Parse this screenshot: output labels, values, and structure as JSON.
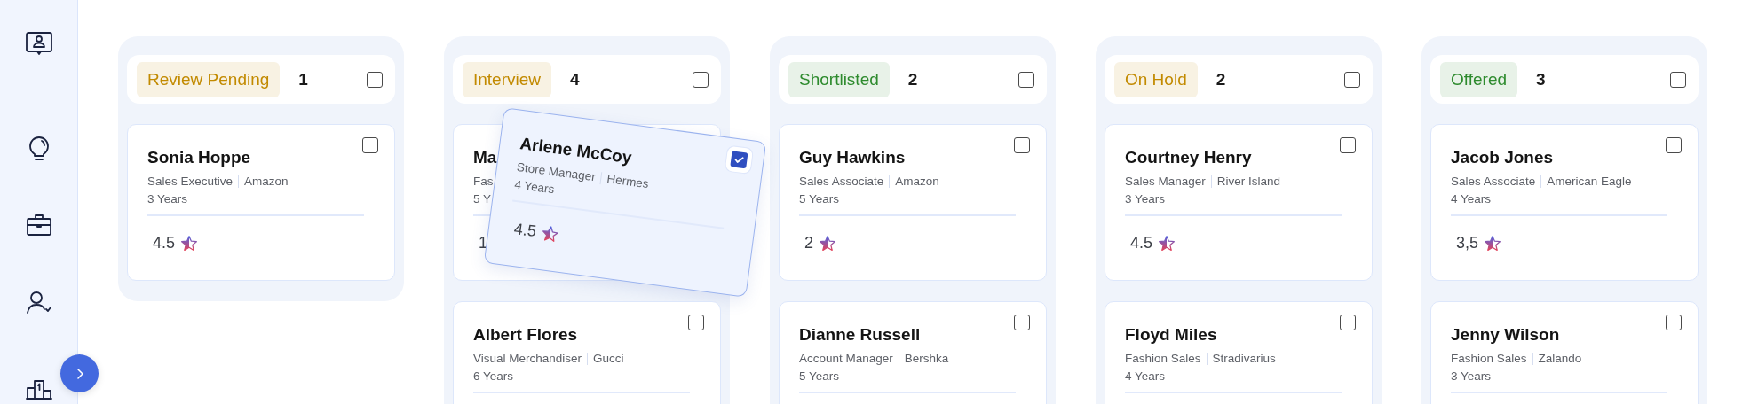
{
  "columns": [
    {
      "status": "Review Pending",
      "color": "#c28a00",
      "count": "1",
      "checked": false,
      "cards": [
        {
          "name": "Sonia Hoppe",
          "role": "Sales Executive",
          "company": "Amazon",
          "years": "3 Years",
          "rating": "4.5",
          "checked": false
        }
      ]
    },
    {
      "status": "Interview",
      "color": "#c28a00",
      "count": "4",
      "checked": false,
      "cards": [
        {
          "kind": "covered",
          "name": "Ma",
          "role": "Fas",
          "years": "5 Y",
          "rating": "1"
        },
        {
          "name": "Albert Flores",
          "role": "Visual Merchandiser",
          "company": "Gucci",
          "years": "6 Years",
          "checked": false
        }
      ],
      "dragged_card": {
        "name": "Arlene McCoy",
        "role": "Store Manager",
        "company": "Hermes",
        "years": "4 Years",
        "rating": "4.5",
        "checked": true
      }
    },
    {
      "status": "Shortlisted",
      "color": "#2e8b2e",
      "count": "2",
      "checked": false,
      "cards": [
        {
          "name": "Guy Hawkins",
          "role": "Sales Associate",
          "company": "Amazon",
          "years": "5 Years",
          "rating": "2",
          "checked": false
        },
        {
          "name": "Dianne Russell",
          "role": "Account Manager",
          "company": "Bershka",
          "years": "5 Years",
          "checked": false
        }
      ]
    },
    {
      "status": "On Hold",
      "color": "#c28a00",
      "count": "2",
      "checked": false,
      "cards": [
        {
          "name": "Courtney Henry",
          "role": "Sales Manager",
          "company": "River Island",
          "years": "3 Years",
          "rating": "4.5",
          "checked": false
        },
        {
          "name": "Floyd Miles",
          "role": "Fashion Sales",
          "company": "Stradivarius",
          "years": "4 Years",
          "checked": false
        }
      ]
    },
    {
      "status": "Offered",
      "color": "#2e8b2e",
      "count": "3",
      "checked": false,
      "cards": [
        {
          "name": "Jacob Jones",
          "role": "Sales Associate",
          "company": "American Eagle",
          "years": "4 Years",
          "rating": "3,5",
          "checked": false
        },
        {
          "name": "Jenny Wilson",
          "role": "Fashion Sales",
          "company": "Zalando",
          "years": "3 Years",
          "checked": false
        }
      ]
    }
  ]
}
